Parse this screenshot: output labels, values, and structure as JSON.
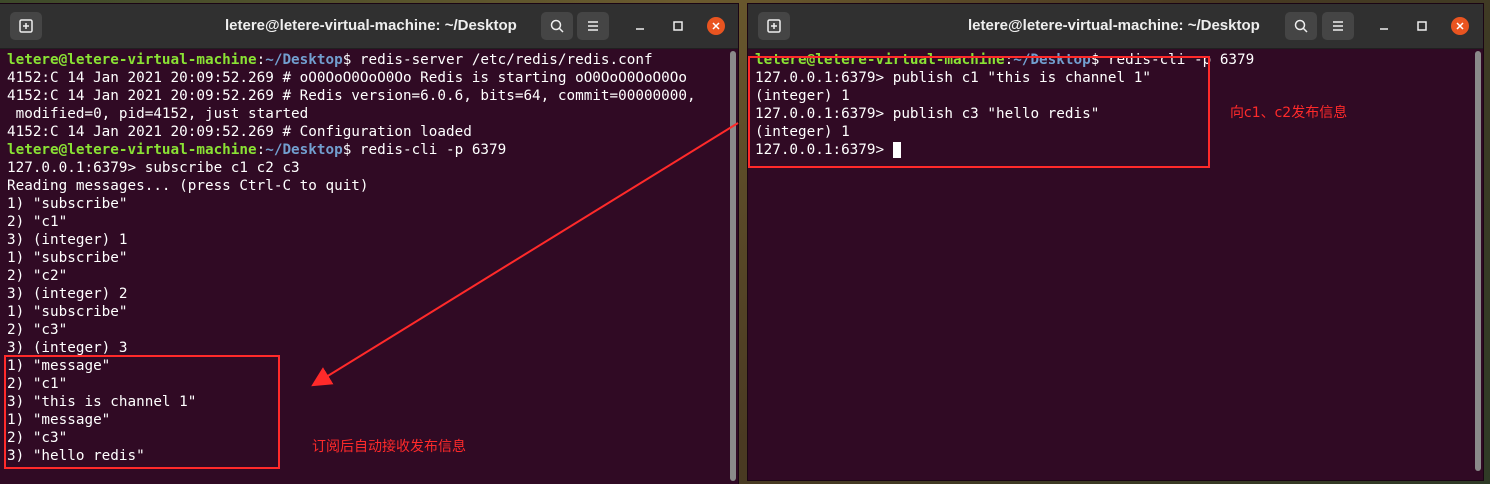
{
  "left_window": {
    "title": "letere@letere-virtual-machine: ~/Desktop",
    "lines": [
      [
        [
          "letere@letere-virtual-machine",
          "green"
        ],
        [
          ":",
          ""
        ],
        [
          "~/Desktop",
          "blue"
        ],
        [
          "$ redis-server /etc/redis/redis.conf",
          ""
        ]
      ],
      [
        [
          "4152:C 14 Jan 2021 20:09:52.269 # oO0OoO0OoO0Oo Redis is starting oO0OoO0OoO0Oo",
          ""
        ]
      ],
      [
        [
          "4152:C 14 Jan 2021 20:09:52.269 # Redis version=6.0.6, bits=64, commit=00000000,",
          ""
        ]
      ],
      [
        [
          " modified=0, pid=4152, just started",
          ""
        ]
      ],
      [
        [
          "4152:C 14 Jan 2021 20:09:52.269 # Configuration loaded",
          ""
        ]
      ],
      [
        [
          "letere@letere-virtual-machine",
          "green"
        ],
        [
          ":",
          ""
        ],
        [
          "~/Desktop",
          "blue"
        ],
        [
          "$ redis-cli -p 6379",
          ""
        ]
      ],
      [
        [
          "127.0.0.1:6379> subscribe c1 c2 c3",
          ""
        ]
      ],
      [
        [
          "Reading messages... (press Ctrl-C to quit)",
          ""
        ]
      ],
      [
        [
          "1) \"subscribe\"",
          ""
        ]
      ],
      [
        [
          "2) \"c1\"",
          ""
        ]
      ],
      [
        [
          "3) (integer) 1",
          ""
        ]
      ],
      [
        [
          "1) \"subscribe\"",
          ""
        ]
      ],
      [
        [
          "2) \"c2\"",
          ""
        ]
      ],
      [
        [
          "3) (integer) 2",
          ""
        ]
      ],
      [
        [
          "1) \"subscribe\"",
          ""
        ]
      ],
      [
        [
          "2) \"c3\"",
          ""
        ]
      ],
      [
        [
          "3) (integer) 3",
          ""
        ]
      ],
      [
        [
          "1) \"message\"",
          ""
        ]
      ],
      [
        [
          "2) \"c1\"",
          ""
        ]
      ],
      [
        [
          "3) \"this is channel 1\"",
          ""
        ]
      ],
      [
        [
          "1) \"message\"",
          ""
        ]
      ],
      [
        [
          "2) \"c3\"",
          ""
        ]
      ],
      [
        [
          "3) \"hello redis\"",
          ""
        ]
      ]
    ]
  },
  "right_window": {
    "title": "letere@letere-virtual-machine: ~/Desktop",
    "lines": [
      [
        [
          "letere@letere-virtual-machine",
          "green"
        ],
        [
          ":",
          ""
        ],
        [
          "~/Desktop",
          "blue"
        ],
        [
          "$ redis-cli -p 6379",
          ""
        ]
      ],
      [
        [
          "127.0.0.1:6379> publish c1 \"this is channel 1\"",
          ""
        ]
      ],
      [
        [
          "(integer) 1",
          ""
        ]
      ],
      [
        [
          "127.0.0.1:6379> publish c3 \"hello redis\"",
          ""
        ]
      ],
      [
        [
          "(integer) 1",
          ""
        ]
      ],
      [
        [
          "127.0.0.1:6379> ",
          ""
        ]
      ]
    ]
  },
  "annotations": {
    "publish_note": "向c1、c2发布信息",
    "subscribe_note": "订阅后自动接收发布信息"
  },
  "colors": {
    "terminal_bg": "#300a24",
    "prompt_user": "#8ae234",
    "prompt_path": "#729fcf",
    "annotation": "#ff2a2a",
    "close_button": "#e95420"
  }
}
